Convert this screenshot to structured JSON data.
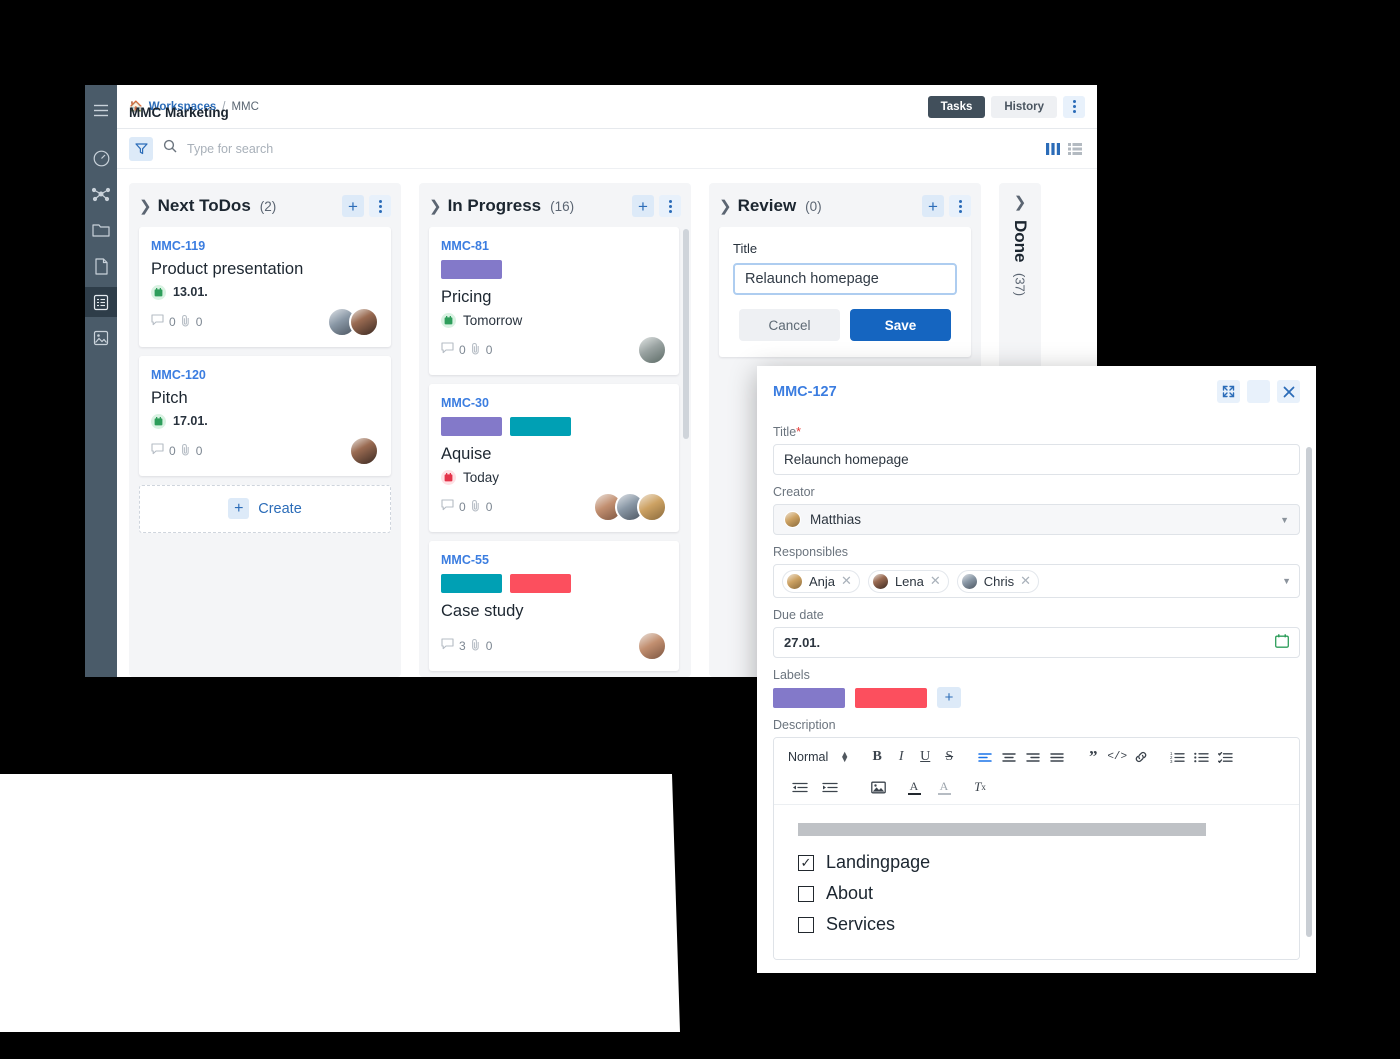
{
  "colors": {
    "label_purple": "#8379c9",
    "label_teal": "#00a0b4",
    "label_red": "#fc4f5e",
    "accent_blue": "#2b6cb8",
    "rail_bg": "#4a5b69",
    "primary_button": "#1565c0"
  },
  "rail": {
    "items": [
      {
        "icon": "hamburger-menu-icon",
        "active": false
      },
      {
        "icon": "dashboard-gauge-icon",
        "active": false
      },
      {
        "icon": "network-graph-icon",
        "active": false
      },
      {
        "icon": "folder-icon",
        "active": false
      },
      {
        "icon": "document-icon",
        "active": false
      },
      {
        "icon": "task-list-icon",
        "active": true
      },
      {
        "icon": "image-board-icon",
        "active": false
      }
    ]
  },
  "header": {
    "breadcrumb": {
      "home_icon": "home-icon",
      "root": "Workspaces",
      "separator": "/",
      "current": "MMC"
    },
    "title": "MMC Marketing",
    "tabs": [
      {
        "label": "Tasks",
        "active": true
      },
      {
        "label": "History",
        "active": false
      }
    ],
    "more_menu_icon": "kebab-menu-icon"
  },
  "search": {
    "filter_icon": "filter-funnel-icon",
    "search_icon": "search-icon",
    "placeholder": "Type for search",
    "value": "",
    "view_board_icon": "board-view-icon",
    "view_list_icon": "list-view-icon"
  },
  "board": {
    "columns": [
      {
        "name": "Next ToDos",
        "count": "(2)",
        "collapse_icon": "chevron-right-icon",
        "add_label": "+",
        "menu_icon": "kebab-menu-icon",
        "cards": [
          {
            "key": "MMC-119",
            "title": "Product presentation",
            "labels": [],
            "due": "13.01.",
            "due_state": "green",
            "due_icon": "calendar-icon",
            "comments": "0",
            "attachments": "0",
            "comment_icon": "comment-icon",
            "attach_icon": "paperclip-icon",
            "avatars": [
              "f5",
              "f2"
            ]
          },
          {
            "key": "MMC-120",
            "title": "Pitch",
            "labels": [],
            "due": "17.01.",
            "due_state": "green",
            "due_icon": "calendar-icon",
            "comments": "0",
            "attachments": "0",
            "comment_icon": "comment-icon",
            "attach_icon": "paperclip-icon",
            "avatars": [
              "f2"
            ]
          }
        ],
        "create_label": "Create",
        "create_icon": "plus-icon"
      },
      {
        "name": "In Progress",
        "count": "(16)",
        "collapse_icon": "chevron-right-icon",
        "add_label": "+",
        "menu_icon": "kebab-menu-icon",
        "cards": [
          {
            "key": "MMC-81",
            "title": "Pricing",
            "labels": [
              "#8379c9"
            ],
            "due": "Tomorrow",
            "due_state": "green",
            "due_icon": "calendar-icon",
            "comments": "0",
            "attachments": "0",
            "comment_icon": "comment-icon",
            "attach_icon": "paperclip-icon",
            "avatars": [
              "f3"
            ]
          },
          {
            "key": "MMC-30",
            "title": "Aquise",
            "labels": [
              "#8379c9",
              "#00a0b4"
            ],
            "due": "Today",
            "due_state": "red",
            "due_icon": "calendar-icon",
            "comments": "0",
            "attachments": "0",
            "comment_icon": "comment-icon",
            "attach_icon": "paperclip-icon",
            "avatars": [
              "f7",
              "f5",
              "f6"
            ]
          },
          {
            "key": "MMC-55",
            "title": "Case study",
            "labels": [
              "#00a0b4",
              "#fc4f5e"
            ],
            "due": "",
            "due_state": "",
            "due_icon": "",
            "comments": "3",
            "attachments": "0",
            "comment_icon": "comment-icon",
            "attach_icon": "paperclip-icon",
            "avatars": [
              "f7"
            ]
          }
        ]
      },
      {
        "name": "Review",
        "count": "(0)",
        "collapse_icon": "chevron-right-icon",
        "add_label": "+",
        "menu_icon": "kebab-menu-icon",
        "inline_form": {
          "label": "Title",
          "value": "Relaunch homepage",
          "cancel_label": "Cancel",
          "save_label": "Save"
        }
      }
    ],
    "collapsed_column": {
      "name": "Done",
      "count": "(37)",
      "expand_icon": "chevron-down-icon"
    }
  },
  "modal": {
    "key": "MMC-127",
    "expand_icon": "expand-fullscreen-icon",
    "menu_icon": "kebab-menu-icon",
    "close_icon": "close-icon",
    "fields": {
      "title_label": "Title",
      "title_required": "*",
      "title_value": "Relaunch homepage",
      "creator_label": "Creator",
      "creator_name": "Matthias",
      "responsibles_label": "Responsibles",
      "responsibles": [
        "Anja",
        "Lena",
        "Chris"
      ],
      "chip_remove_icon": "close-small-icon",
      "due_label": "Due date",
      "due_value": "27.01.",
      "due_icon": "calendar-icon",
      "labels_label": "Labels",
      "labels": [
        "#8379c9",
        "#fc4f5e"
      ],
      "label_add": "+",
      "description_label": "Description"
    },
    "toolbar": {
      "block_format": "Normal",
      "stepper_icon": "updown-stepper-icon",
      "row1": [
        {
          "icon": "bold-icon",
          "glyph": "B"
        },
        {
          "icon": "italic-icon",
          "glyph": "I"
        },
        {
          "icon": "underline-icon",
          "glyph": "U"
        },
        {
          "icon": "strikethrough-icon",
          "glyph": "S"
        },
        {
          "icon": "align-left-icon",
          "glyph": ""
        },
        {
          "icon": "align-center-icon",
          "glyph": ""
        },
        {
          "icon": "align-right-icon",
          "glyph": ""
        },
        {
          "icon": "align-justify-icon",
          "glyph": ""
        },
        {
          "icon": "blockquote-icon",
          "glyph": "”"
        },
        {
          "icon": "code-block-icon",
          "glyph": "</>"
        },
        {
          "icon": "link-icon",
          "glyph": ""
        },
        {
          "icon": "ordered-list-icon",
          "glyph": ""
        },
        {
          "icon": "bullet-list-icon",
          "glyph": ""
        },
        {
          "icon": "checklist-icon",
          "glyph": ""
        }
      ],
      "row2": [
        {
          "icon": "outdent-icon",
          "glyph": ""
        },
        {
          "icon": "indent-icon",
          "glyph": ""
        },
        {
          "icon": "insert-image-icon",
          "glyph": ""
        },
        {
          "icon": "font-color-icon",
          "glyph": "A"
        },
        {
          "icon": "highlight-color-icon",
          "glyph": "A"
        },
        {
          "icon": "clear-formatting-icon",
          "glyph": "Tx"
        }
      ]
    },
    "description": {
      "redacted_bar": true,
      "checklist": [
        {
          "text": "Landingpage",
          "checked": true
        },
        {
          "text": "About",
          "checked": false
        },
        {
          "text": "Services",
          "checked": false
        }
      ],
      "checked_glyph": "✓"
    }
  }
}
